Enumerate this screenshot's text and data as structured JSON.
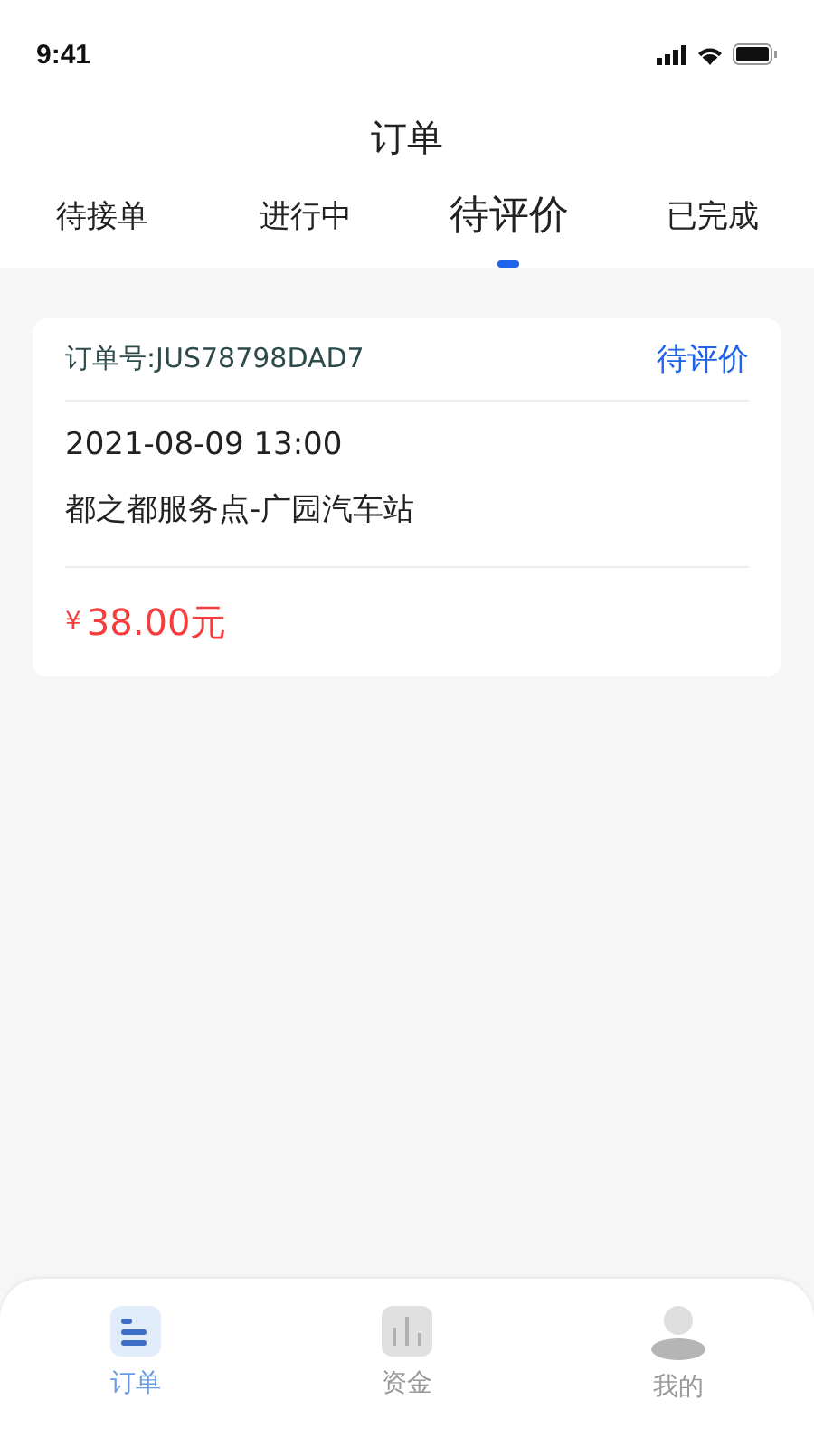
{
  "status_bar": {
    "time": "9:41"
  },
  "title": "订单",
  "tabs": [
    {
      "label": "待接单",
      "selected": false
    },
    {
      "label": "进行中",
      "selected": false
    },
    {
      "label": "待评价",
      "selected": true
    },
    {
      "label": "已完成",
      "selected": false
    }
  ],
  "orders": [
    {
      "order_no": "订单号:JUS78798DAD7",
      "status": "待评价",
      "datetime": "2021-08-09 13:00",
      "route": "都之都服务点-广园汽车站",
      "currency": "¥",
      "amount": "38.00元"
    }
  ],
  "bottom_nav": [
    {
      "kind": "orders",
      "label": "订单",
      "selected": true
    },
    {
      "kind": "funds",
      "label": "资金",
      "selected": false
    },
    {
      "kind": "profile",
      "label": "我的",
      "selected": false
    }
  ]
}
